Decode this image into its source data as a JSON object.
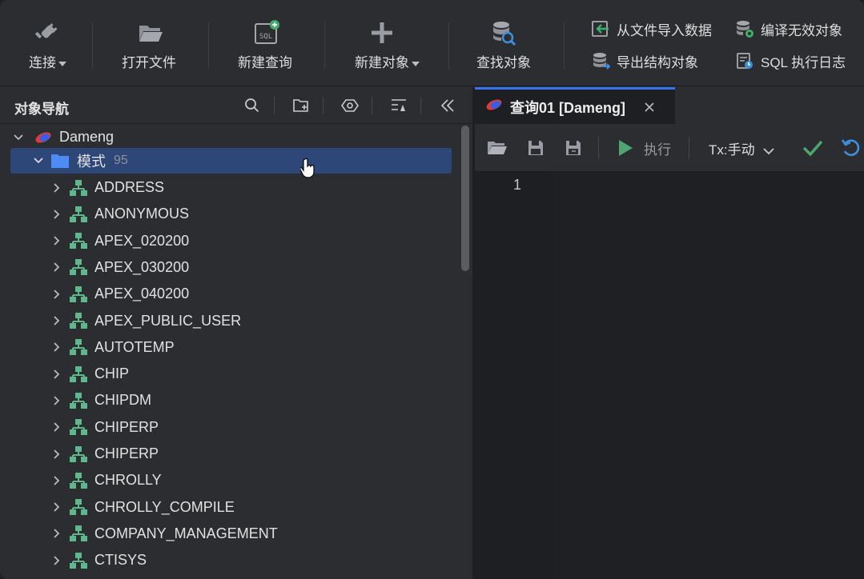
{
  "toolbar": {
    "connect": "连接",
    "open_file": "打开文件",
    "new_query": "新建查询",
    "new_object": "新建对象",
    "find_object": "查找对象",
    "import_data": "从文件导入数据",
    "compile_invalid": "编译无效对象",
    "export_structure": "导出结构对象",
    "sql_log": "SQL 执行日志"
  },
  "navigator": {
    "title": "对象导航",
    "connection": "Dameng",
    "schema_folder": "模式",
    "schema_count": "95",
    "schemas": [
      "ADDRESS",
      "ANONYMOUS",
      "APEX_020200",
      "APEX_030200",
      "APEX_040200",
      "APEX_PUBLIC_USER",
      "AUTOTEMP",
      "CHIP",
      "CHIPDM",
      "CHIPERP",
      "CHIPERP",
      "CHROLLY",
      "CHROLLY_COMPILE",
      "COMPANY_MANAGEMENT",
      "CTISYS"
    ]
  },
  "query": {
    "tab_label": "查询01 [Dameng]",
    "execute": "执行",
    "tx_mode": "Tx:手动",
    "line_number": "1"
  },
  "colors": {
    "accent": "#3574f0",
    "selection": "#2d4778",
    "schema_icon": "#5fb88b",
    "run_green": "#4ea66e",
    "folder_blue": "#4d8cf5"
  }
}
